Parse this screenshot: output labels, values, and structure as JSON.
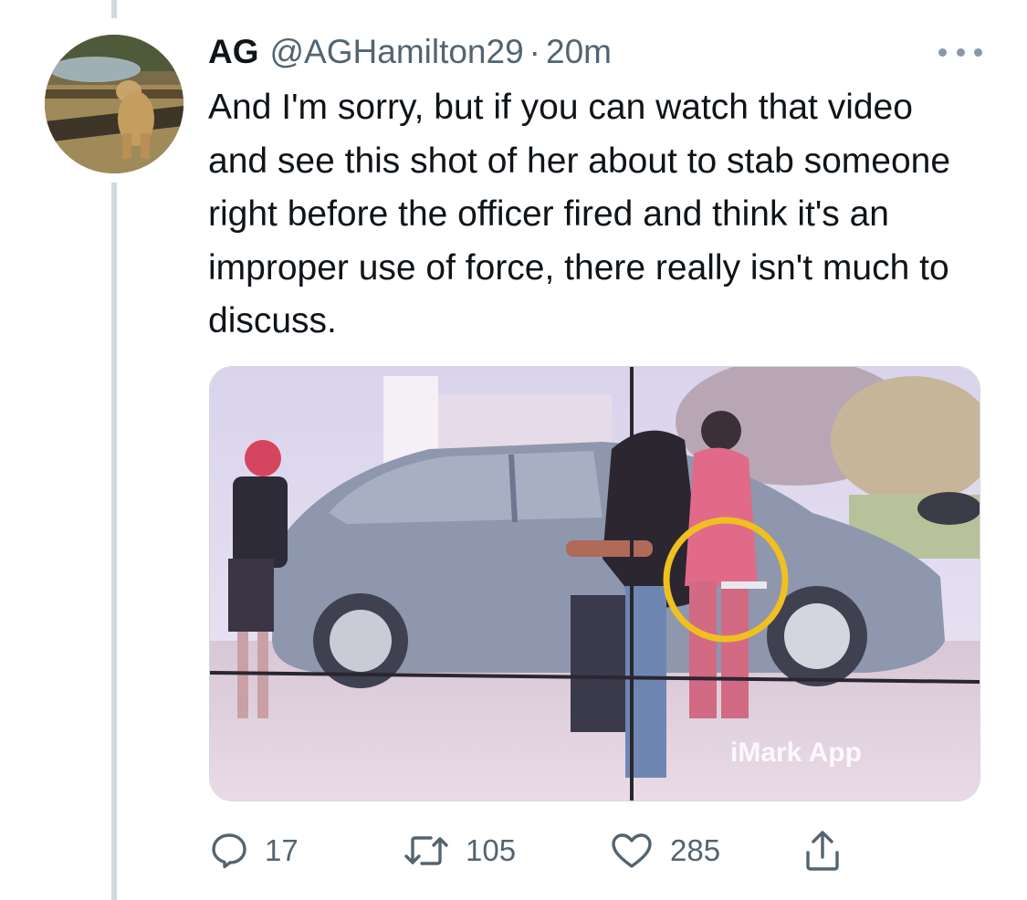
{
  "tweet": {
    "display_name": "AG",
    "handle": "@AGHamilton29",
    "separator": "·",
    "time": "20m",
    "text": "And I'm sorry, but if you can watch that video and see this shot of her about to stab someone right before the officer fired and think it's an improper use of force, there really isn't much to discuss."
  },
  "media": {
    "watermark": "iMark App"
  },
  "actions": {
    "reply": {
      "icon": "reply-icon",
      "count": "17"
    },
    "retweet": {
      "icon": "retweet-icon",
      "count": "105"
    },
    "like": {
      "icon": "heart-icon",
      "count": "285"
    },
    "share": {
      "icon": "share-icon"
    }
  },
  "colors": {
    "text": "#0f1419",
    "secondary": "#536471",
    "thread_line": "#cfd9de",
    "highlight_circle": "#f0c020"
  }
}
